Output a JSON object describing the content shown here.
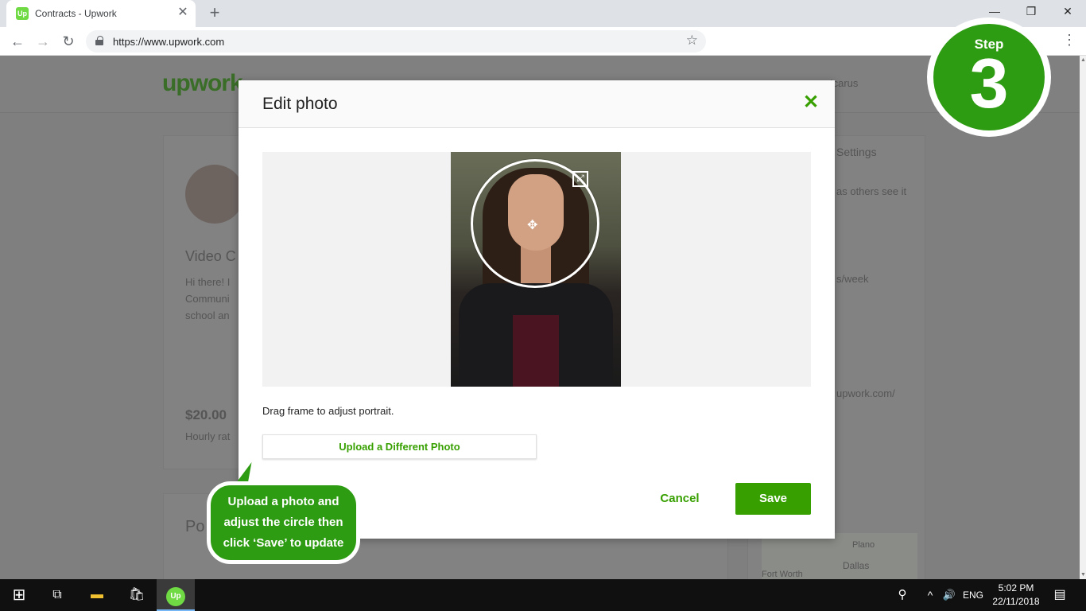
{
  "browser": {
    "tab_title": "Contracts - Upwork",
    "favicon_text": "Up",
    "tab_close": "✕",
    "new_tab": "+",
    "url": "https://www.upwork.com",
    "minimize": "—",
    "restore": "❐",
    "close": "✕",
    "back": "←",
    "forward": "→",
    "reload": "↻",
    "star": "☆",
    "menu": "⋮"
  },
  "page_bg": {
    "logo": "upwork",
    "username": "Icarus",
    "video_heading": "Video C",
    "intro_line1": "Hi there! I",
    "intro_line2": "Communi",
    "intro_line3": "school an",
    "rate": "$20.00",
    "rate_label": "Hourly rat",
    "portfolio_heading": "Po",
    "settings": "Settings",
    "as_others": "as others see it",
    "per_week": "s/week",
    "profile_url": "upwork.com/",
    "map_plano": "Plano",
    "map_dallas": "Dallas",
    "map_fortworth": "Fort Worth"
  },
  "modal": {
    "title": "Edit photo",
    "close_icon": "✕",
    "hint": "Drag frame to adjust portrait.",
    "upload_label": "Upload a Different Photo",
    "cancel_label": "Cancel",
    "save_label": "Save",
    "expand_glyph": "⤢",
    "move_glyph": "✥"
  },
  "step_badge": {
    "label": "Step",
    "number": "3"
  },
  "callout": {
    "line1": "Upload a photo and",
    "line2": "adjust the circle then",
    "line3": "click ‘Save’ to update"
  },
  "taskbar": {
    "start_glyph": "⊞",
    "taskview_glyph": "⧉",
    "explorer_glyph": "▬",
    "store_glyph": "🛍",
    "upwork_glyph": "Up",
    "people_glyph": "⚲",
    "chevron": "^",
    "volume": "🔊",
    "language": "ENG",
    "time": "5:02 PM",
    "date": "22/11/2018",
    "notification": "▤"
  },
  "colors": {
    "upwork_green": "#37a000",
    "badge_green": "#2e9c12",
    "favicon_green": "#6fda44"
  }
}
